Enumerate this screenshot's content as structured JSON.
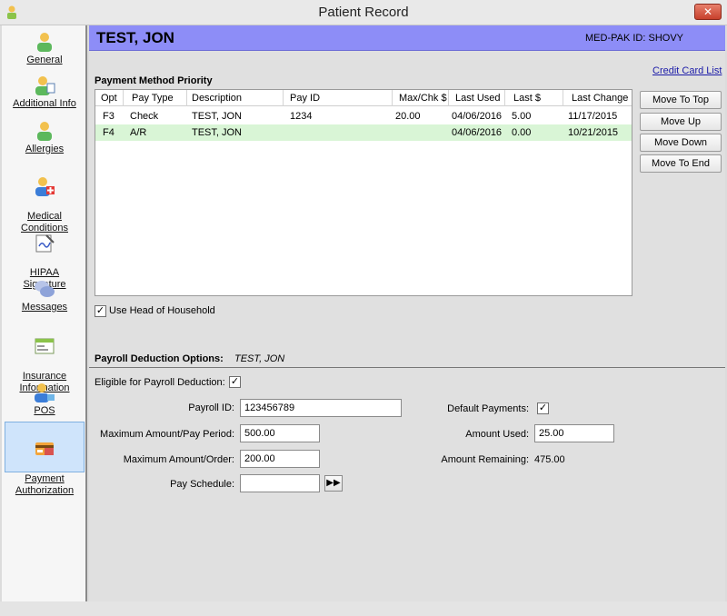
{
  "window": {
    "title": "Patient Record",
    "close_label": "✕"
  },
  "sidebar": {
    "items": [
      {
        "label": "General",
        "icon": "user-icon"
      },
      {
        "label": "Additional Info",
        "icon": "user-info-icon"
      },
      {
        "label": "Allergies",
        "icon": "allergy-icon"
      },
      {
        "label": "Medical\nConditions",
        "icon": "medical-icon"
      },
      {
        "label": "HIPAA\nSignature",
        "icon": "signature-icon"
      },
      {
        "label": "Messages",
        "icon": "messages-icon"
      },
      {
        "label": "Insurance\nInformation",
        "icon": "insurance-icon"
      },
      {
        "label": "POS",
        "icon": "pos-icon"
      },
      {
        "label": "Payment\nAuthorization",
        "icon": "payment-card-icon"
      }
    ]
  },
  "header": {
    "patient_name": "TEST, JON",
    "medpak_label": "MED-PAK ID: SHOVY"
  },
  "payment_priority": {
    "title": "Payment Method Priority",
    "credit_card_link": "Credit Card List",
    "columns": [
      "Opt",
      "Pay Type",
      "Description",
      "Pay ID",
      "Max/Chk $",
      "Last Used",
      "Last $",
      "Last Change"
    ],
    "rows": [
      {
        "opt": "F3",
        "pay_type": "Check",
        "description": "TEST, JON",
        "pay_id": "1234",
        "max_chk": "20.00",
        "last_used": "04/06/2016",
        "last_amt": "5.00",
        "last_change": "11/17/2015"
      },
      {
        "opt": "F4",
        "pay_type": "A/R",
        "description": "TEST, JON",
        "pay_id": "",
        "max_chk": "",
        "last_used": "04/06/2016",
        "last_amt": "0.00",
        "last_change": "10/21/2015"
      }
    ],
    "buttons": {
      "move_top": "Move To Top",
      "move_up": "Move Up",
      "move_down": "Move Down",
      "move_end": "Move To End"
    },
    "use_head_label": "Use Head of Household",
    "use_head_checked": "✓"
  },
  "payroll": {
    "title": "Payroll Deduction Options:",
    "patient": "TEST, JON",
    "eligible_label": "Eligible for Payroll Deduction:",
    "eligible_checked": "✓",
    "payroll_id_label": "Payroll ID:",
    "payroll_id_value": "123456789",
    "max_period_label": "Maximum Amount/Pay Period:",
    "max_period_value": "500.00",
    "max_order_label": "Maximum Amount/Order:",
    "max_order_value": "200.00",
    "pay_schedule_label": "Pay Schedule:",
    "pay_schedule_value": "",
    "pay_schedule_button": "▶▶",
    "default_payments_label": "Default Payments:",
    "default_payments_checked": "✓",
    "amount_used_label": "Amount Used:",
    "amount_used_value": "25.00",
    "amount_remaining_label": "Amount Remaining:",
    "amount_remaining_value": "475.00"
  }
}
